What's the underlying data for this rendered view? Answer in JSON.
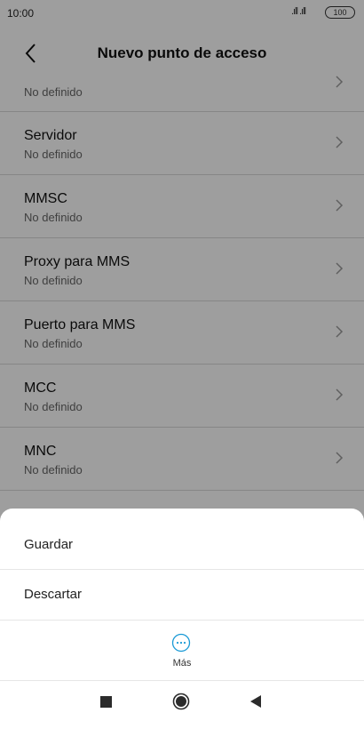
{
  "status_bar": {
    "time": "10:00",
    "signal": ".ıll .ıll",
    "battery": "100"
  },
  "header": {
    "title": "Nuevo punto de acceso"
  },
  "list": {
    "items": [
      {
        "label": "",
        "value": "No definido"
      },
      {
        "label": "Servidor",
        "value": "No definido"
      },
      {
        "label": "MMSC",
        "value": "No definido"
      },
      {
        "label": "Proxy para MMS",
        "value": "No definido"
      },
      {
        "label": "Puerto para MMS",
        "value": "No definido"
      },
      {
        "label": "MCC",
        "value": "No definido"
      },
      {
        "label": "MNC",
        "value": "No definido"
      }
    ]
  },
  "sheet": {
    "save_label": "Guardar",
    "discard_label": "Descartar",
    "more_label": "Más"
  },
  "colors": {
    "accent": "#1a9ad6",
    "overlay": "rgba(0,0,0,0.38)"
  }
}
